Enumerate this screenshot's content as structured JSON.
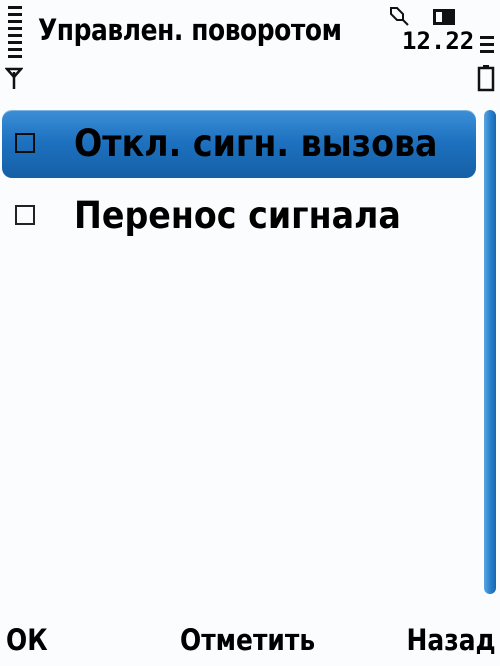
{
  "status_bar": {
    "title": "Управлен. поворотом",
    "time": "12.22",
    "icons": [
      "signal-bars-icon",
      "antenna-icon",
      "alarm-icon",
      "sim-card-icon",
      "battery-level-icon",
      "battery-icon"
    ]
  },
  "list": {
    "items": [
      {
        "label": "Откл. сигн. вызова",
        "checked": false,
        "selected": true
      },
      {
        "label": "Перенос сигнала",
        "checked": false,
        "selected": false
      }
    ]
  },
  "softkeys": {
    "left": "ОК",
    "middle": "Отметить",
    "right": "Назад"
  },
  "colors": {
    "highlight": "#1e72c0",
    "scrollbar": "#2a82cf",
    "background": "#fbfcfd",
    "text": "#000000"
  }
}
